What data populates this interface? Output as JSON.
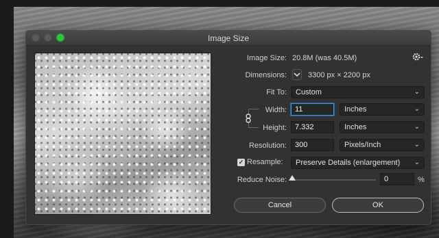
{
  "dialog": {
    "title": "Image Size"
  },
  "image_size": {
    "label": "Image Size:",
    "value": "20.8M (was 40.5M)"
  },
  "dimensions": {
    "label": "Dimensions:",
    "value": "3300 px  ×  2200 px"
  },
  "fit_to": {
    "label": "Fit To:",
    "value": "Custom"
  },
  "width": {
    "label": "Width:",
    "value": "11",
    "unit": "Inches"
  },
  "height": {
    "label": "Height:",
    "value": "7.332",
    "unit": "Inches"
  },
  "resolution": {
    "label": "Resolution:",
    "value": "300",
    "unit": "Pixels/Inch"
  },
  "resample": {
    "label": "Resample:",
    "checked": true,
    "value": "Preserve Details (enlargement)"
  },
  "reduce_noise": {
    "label": "Reduce Noise:",
    "value": "0",
    "unit": "%"
  },
  "buttons": {
    "cancel": "Cancel",
    "ok": "OK"
  },
  "icons": {
    "gear": "gear-icon",
    "link": "chain-link-icon",
    "chevron": "chevron-down-icon"
  },
  "colors": {
    "accent_focus": "#4a8fe0",
    "zoom_button": "#2fc240"
  }
}
